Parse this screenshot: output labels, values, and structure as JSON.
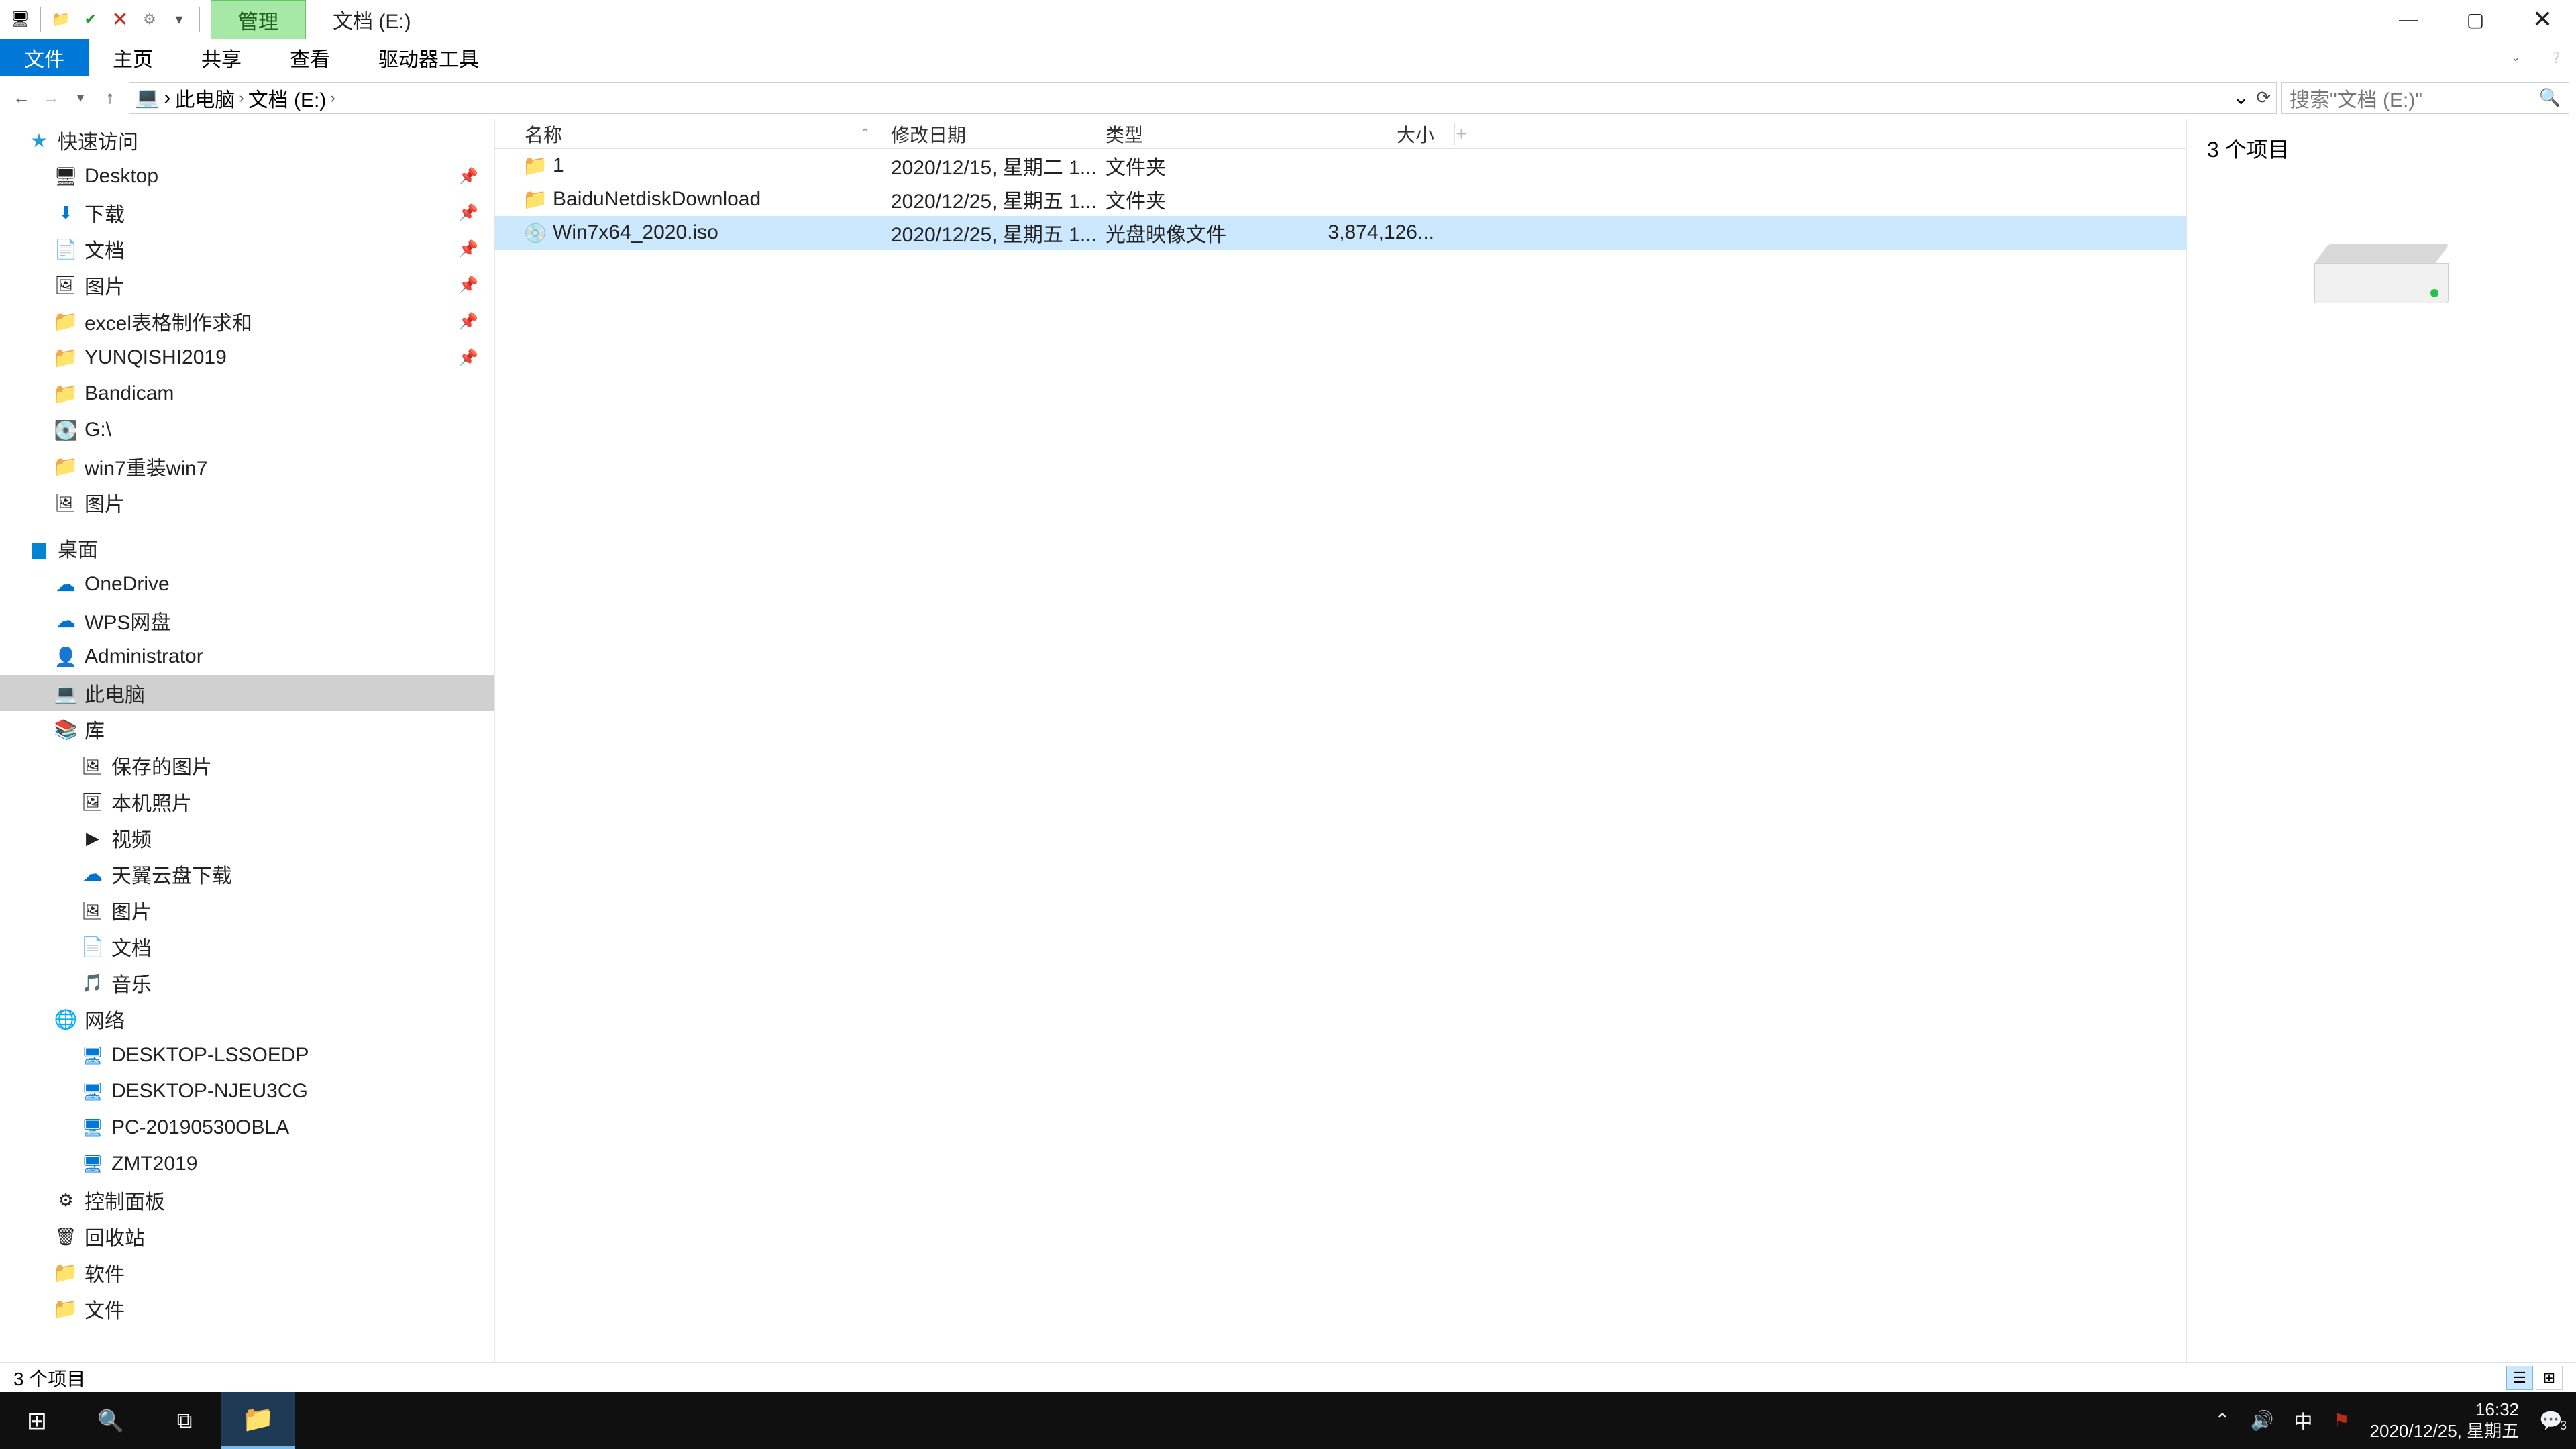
{
  "titlebar": {
    "manage_tab": "管理",
    "title": "文档 (E:)"
  },
  "ribbon": {
    "file": "文件",
    "home": "主页",
    "share": "共享",
    "view": "查看",
    "drivetools": "驱动器工具"
  },
  "path": {
    "root": "此电脑",
    "seg1": "文档 (E:)"
  },
  "search": {
    "placeholder": "搜索\"文档 (E:)\""
  },
  "nav": {
    "quick_access": "快速访问",
    "desktop": "Desktop",
    "downloads": "下载",
    "documents": "文档",
    "pictures": "图片",
    "excel": "excel表格制作求和",
    "yunqishi": "YUNQISHI2019",
    "bandicam": "Bandicam",
    "g_drive": "G:\\",
    "win7": "win7重装win7",
    "pictures2": "图片",
    "desktop_section": "桌面",
    "onedrive": "OneDrive",
    "wps": "WPS网盘",
    "administrator": "Administrator",
    "this_pc": "此电脑",
    "libraries": "库",
    "saved_pics": "保存的图片",
    "camera_roll": "本机照片",
    "videos": "视频",
    "tianyi": "天翼云盘下载",
    "pics3": "图片",
    "docs2": "文档",
    "music": "音乐",
    "network": "网络",
    "pc1": "DESKTOP-LSSOEDP",
    "pc2": "DESKTOP-NJEU3CG",
    "pc3": "PC-20190530OBLA",
    "pc4": "ZMT2019",
    "control_panel": "控制面板",
    "recycle": "回收站",
    "software": "软件",
    "files": "文件"
  },
  "filehdr": {
    "name": "名称",
    "date": "修改日期",
    "type": "类型",
    "size": "大小"
  },
  "files": [
    {
      "name": "1",
      "icon": "folder",
      "date": "2020/12/15, 星期二 1...",
      "type": "文件夹",
      "size": ""
    },
    {
      "name": "BaiduNetdiskDownload",
      "icon": "folder",
      "date": "2020/12/25, 星期五 1...",
      "type": "文件夹",
      "size": ""
    },
    {
      "name": "Win7x64_2020.iso",
      "icon": "iso",
      "date": "2020/12/25, 星期五 1...",
      "type": "光盘映像文件",
      "size": "3,874,126..."
    }
  ],
  "preview": {
    "count_text": "3 个项目"
  },
  "statusbar": {
    "text": "3 个项目"
  },
  "clock": {
    "time": "16:32",
    "date": "2020/12/25, 星期五"
  },
  "ime": "中",
  "action_badge": "3"
}
